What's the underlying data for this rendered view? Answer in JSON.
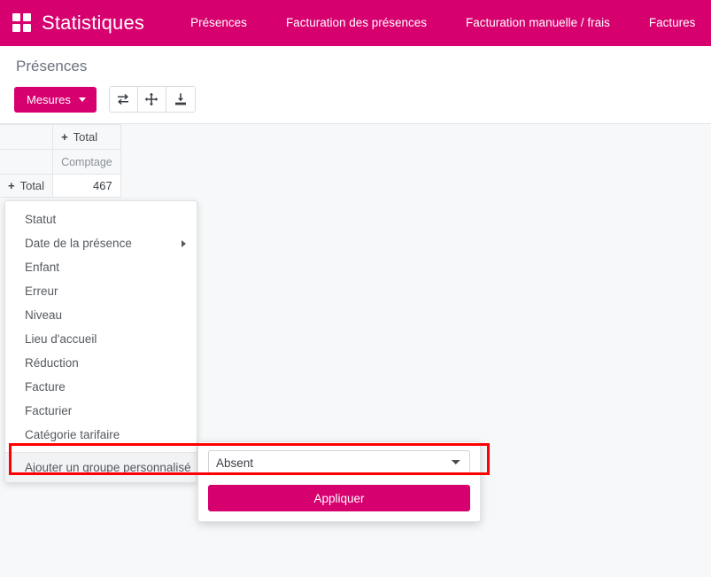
{
  "navbar": {
    "apps_icon": "apps-grid-icon",
    "brand": "Statistiques",
    "items": [
      {
        "label": "Présences"
      },
      {
        "label": "Facturation des présences"
      },
      {
        "label": "Facturation manuelle / frais"
      },
      {
        "label": "Factures"
      }
    ]
  },
  "control_panel": {
    "breadcrumb": "Présences",
    "measures_button": "Mesures",
    "tools": [
      {
        "name": "flip-axis-icon",
        "title": "Inverser les axes"
      },
      {
        "name": "expand-all-icon",
        "title": "Tout déplier"
      },
      {
        "name": "download-xlsx-icon",
        "title": "Télécharger xlsx"
      }
    ]
  },
  "pivot": {
    "column_header": "Total",
    "measure_header": "Comptage",
    "row_header": "Total",
    "value": "467",
    "expand_glyph": "+"
  },
  "dropdown": {
    "items": [
      {
        "label": "Statut",
        "has_submenu": false
      },
      {
        "label": "Date de la présence",
        "has_submenu": true
      },
      {
        "label": "Enfant",
        "has_submenu": false
      },
      {
        "label": "Erreur",
        "has_submenu": false
      },
      {
        "label": "Niveau",
        "has_submenu": false
      },
      {
        "label": "Lieu d'accueil",
        "has_submenu": false
      },
      {
        "label": "Réduction",
        "has_submenu": false
      },
      {
        "label": "Facture",
        "has_submenu": false
      },
      {
        "label": "Facturier",
        "has_submenu": false
      },
      {
        "label": "Catégorie tarifaire",
        "has_submenu": false
      }
    ],
    "custom_group": {
      "label": "Ajouter un groupe personnalisé",
      "has_submenu": true
    }
  },
  "submenu": {
    "select_value": "Absent",
    "select_options": [
      "Absent"
    ],
    "apply_button": "Appliquer"
  },
  "colors": {
    "brand": "#d6006e",
    "highlight": "#ff0000",
    "page_background": "#f7f8f9",
    "text": "#4c4c4c"
  }
}
